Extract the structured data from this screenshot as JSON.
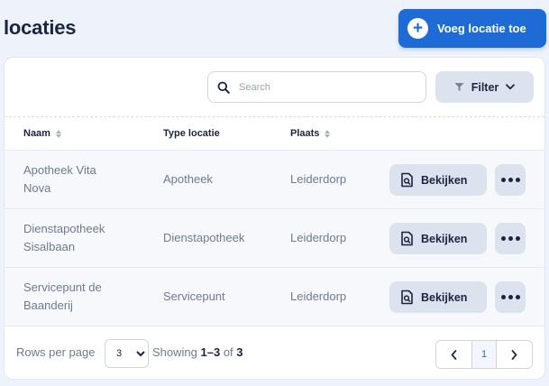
{
  "header": {
    "title": "locaties",
    "add_button_label": "Voeg locatie toe"
  },
  "toolbar": {
    "search_placeholder": "Search",
    "search_value": "",
    "filter_label": "Filter"
  },
  "table": {
    "columns": [
      "Naam",
      "Type locatie",
      "Plaats"
    ],
    "rows": [
      {
        "naam_line1": "Apotheek Vita",
        "naam_line2": "Nova",
        "type": "Apotheek",
        "plaats": "Leiderdorp",
        "view_label": "Bekijken"
      },
      {
        "naam_line1": "Dienstapotheek",
        "naam_line2": "Sisalbaan",
        "type": "Dienstapotheek",
        "plaats": "Leiderdorp",
        "view_label": "Bekijken"
      },
      {
        "naam_line1": "Servicepunt de",
        "naam_line2": "Baanderij",
        "type": "Servicepunt",
        "plaats": "Leiderdorp",
        "view_label": "Bekijken"
      }
    ]
  },
  "footer": {
    "rows_per_page_label": "Rows per page",
    "rows_per_page_value": "3",
    "showing_prefix": "Showing",
    "showing_range": "1–3",
    "showing_of": "of",
    "showing_total": "3",
    "current_page": "1"
  },
  "colors": {
    "accent": "#1e6bd6",
    "background": "#eef2fa",
    "button_secondary": "#dde3ee"
  },
  "icons": [
    "plus-circle-icon",
    "search-icon",
    "filter-icon",
    "chevron-down-icon",
    "document-search-icon",
    "more-dots-icon",
    "sort-icon",
    "chevron-left-icon",
    "chevron-right-icon"
  ]
}
